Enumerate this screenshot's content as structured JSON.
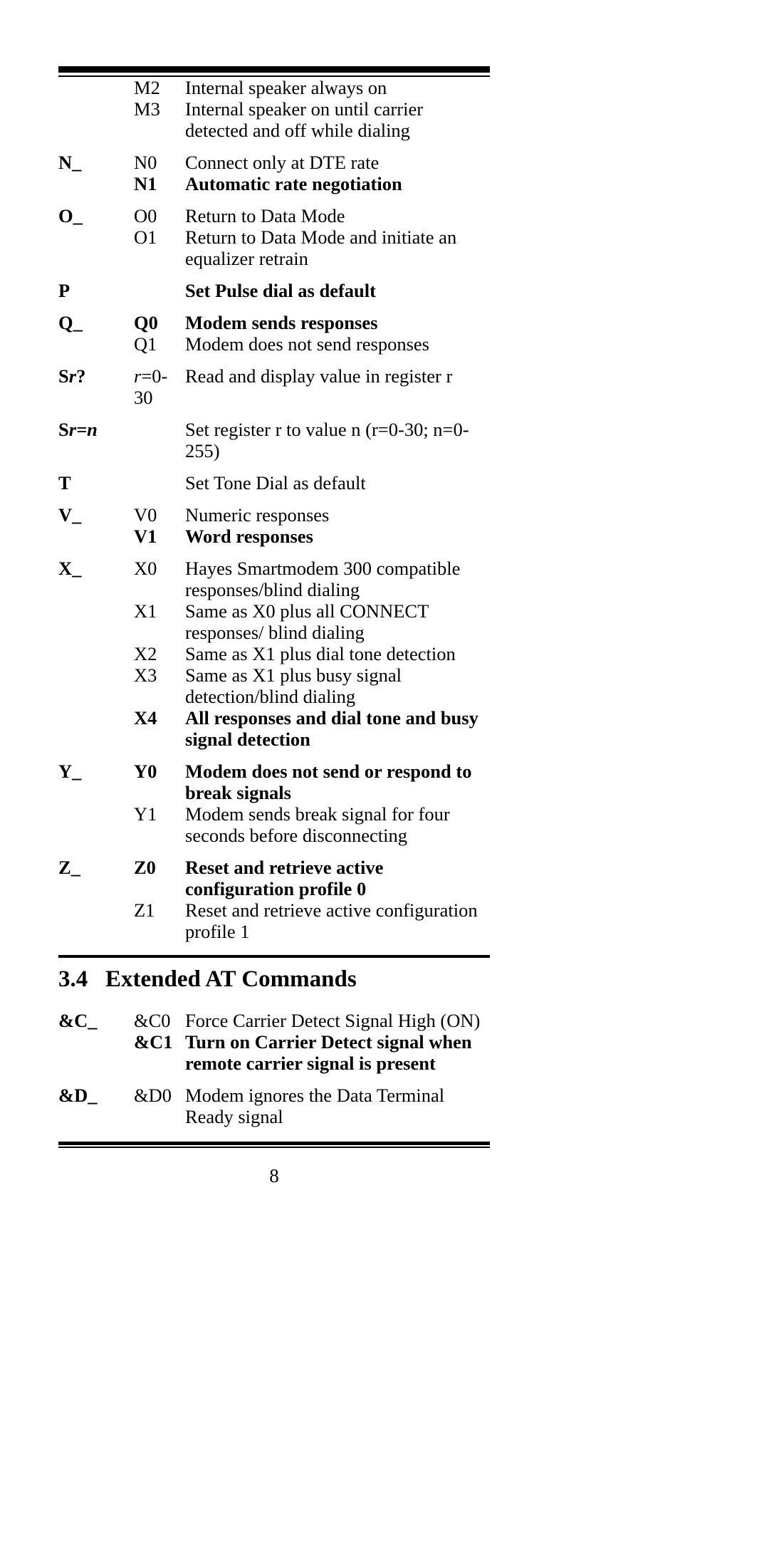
{
  "document": {
    "page_number": "8"
  },
  "rows": [
    {
      "cmd": "",
      "opt": "M2",
      "desc": "Internal speaker always on",
      "bold": false,
      "group_start": false
    },
    {
      "cmd": "",
      "opt": "M3",
      "desc": "Internal speaker on until carrier detected and off while dialing",
      "bold": false,
      "group_start": false
    },
    {
      "cmd": "N_",
      "opt": "N0",
      "desc": "Connect only at DTE rate",
      "bold": false,
      "group_start": true
    },
    {
      "cmd": "",
      "opt": "N1",
      "desc": "Automatic rate negotiation",
      "bold": true,
      "group_start": false
    },
    {
      "cmd": "O_",
      "opt": "O0",
      "desc": "Return to Data Mode",
      "bold": false,
      "group_start": true
    },
    {
      "cmd": "",
      "opt": "O1",
      "desc": "Return to Data Mode and initiate an equalizer retrain",
      "bold": false,
      "group_start": false
    },
    {
      "cmd": "P",
      "opt": "",
      "desc": "Set Pulse dial as default",
      "bold": true,
      "group_start": true
    },
    {
      "cmd": "Q_",
      "opt": "Q0",
      "desc": "Modem sends responses",
      "bold": true,
      "group_start": true
    },
    {
      "cmd": "",
      "opt": "Q1",
      "desc": "Modem does not send responses",
      "bold": false,
      "group_start": false
    },
    {
      "cmd": "Sr?",
      "opt": "r=0-30",
      "desc": "Read and display value in register r",
      "bold": false,
      "group_start": true,
      "cmd_style": "Sr?",
      "opt_style": "r-italic"
    },
    {
      "cmd": "Sr=n",
      "opt": "",
      "desc": "Set register r to value n (r=0-30; n=0-255)",
      "bold": false,
      "group_start": true,
      "cmd_style": "Sr=n"
    },
    {
      "cmd": "T",
      "opt": "",
      "desc": "Set Tone Dial as default",
      "bold": false,
      "group_start": true
    },
    {
      "cmd": "V_",
      "opt": "V0",
      "desc": "Numeric responses",
      "bold": false,
      "group_start": true
    },
    {
      "cmd": "",
      "opt": "V1",
      "desc": "Word responses",
      "bold": true,
      "group_start": false
    },
    {
      "cmd": "X_",
      "opt": "X0",
      "desc": "Hayes Smartmodem 300 compatible responses/blind dialing",
      "bold": false,
      "group_start": true
    },
    {
      "cmd": "",
      "opt": "X1",
      "desc": "Same as X0 plus all CONNECT responses/ blind dialing",
      "bold": false,
      "group_start": false
    },
    {
      "cmd": "",
      "opt": "X2",
      "desc": "Same as X1 plus dial tone detection",
      "bold": false,
      "group_start": false
    },
    {
      "cmd": "",
      "opt": "X3",
      "desc": "Same as X1 plus busy signal detection/blind dialing",
      "bold": false,
      "group_start": false
    },
    {
      "cmd": "",
      "opt": "X4",
      "desc": "All responses and dial tone and busy signal detection",
      "bold": true,
      "group_start": false
    },
    {
      "cmd": "Y_",
      "opt": "Y0",
      "desc": "Modem does not send or respond to break signals",
      "bold": true,
      "group_start": true
    },
    {
      "cmd": "",
      "opt": "Y1",
      "desc": "Modem sends break signal for four  seconds before disconnecting",
      "bold": false,
      "group_start": false
    },
    {
      "cmd": "Z_",
      "opt": "Z0",
      "desc": "Reset and retrieve active configuration profile 0",
      "bold": true,
      "group_start": true
    },
    {
      "cmd": "",
      "opt": "Z1",
      "desc": "Reset and retrieve active configuration profile 1",
      "bold": false,
      "group_start": false
    }
  ],
  "section": {
    "number": "3.4",
    "title": "Extended AT Commands"
  },
  "rows2": [
    {
      "cmd": "&C_",
      "opt": "&C0",
      "desc": "Force Carrier Detect Signal High (ON)",
      "bold": false,
      "group_start": true
    },
    {
      "cmd": "",
      "opt": "&C1",
      "desc": "Turn on Carrier Detect signal when remote carrier signal is present",
      "bold": true,
      "group_start": false
    },
    {
      "cmd": "&D_",
      "opt": "&D0",
      "desc": "Modem ignores the Data Terminal Ready signal",
      "bold": false,
      "group_start": true
    }
  ]
}
